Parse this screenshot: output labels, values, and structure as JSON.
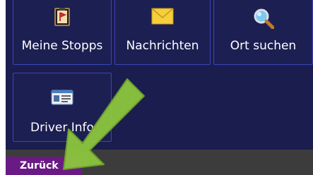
{
  "menu": {
    "tiles": [
      {
        "label": "Meine Stopps",
        "icon": "clipboard-stop-icon"
      },
      {
        "label": "Nachrichten",
        "icon": "envelope-icon"
      },
      {
        "label": "Ort suchen",
        "icon": "magnifier-icon"
      },
      {
        "label": "Driver Info",
        "icon": "id-card-icon"
      }
    ]
  },
  "footer": {
    "back_label": "Zurück"
  },
  "colors": {
    "background": "#1a1d4e",
    "tile_border": "#3b44b8",
    "back_button": "#6a1a84",
    "bottom_bar": "#3c3c3c",
    "arrow": "#8dc63f"
  }
}
